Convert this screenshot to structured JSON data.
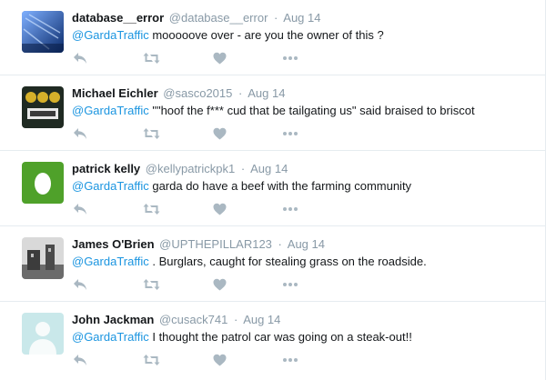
{
  "colors": {
    "mention": "#1b95e0",
    "meta": "#8899a6",
    "action_icon": "#aab8c2",
    "text": "#14171a"
  },
  "icons": {
    "reply": "reply-icon",
    "retweet": "retweet-icon",
    "like": "heart-icon",
    "more": "more-icon"
  },
  "tweets": [
    {
      "name": "database__error",
      "handle": "@database__error",
      "separator": "·",
      "date": "Aug 14",
      "mention": "@GardaTraffic",
      "text": " mooooove over - are you the owner of this ?"
    },
    {
      "name": "Michael Eichler",
      "handle": "@sasco2015",
      "separator": "·",
      "date": "Aug 14",
      "mention": "@GardaTraffic",
      "text": " \"\"hoof the f*** cud that be tailgating us\" said braised to briscot"
    },
    {
      "name": "patrick kelly",
      "handle": "@kellypatrickpk1",
      "separator": "·",
      "date": "Aug 14",
      "mention": "@GardaTraffic",
      "text": " garda do have a beef with the farming community"
    },
    {
      "name": "James O'Brien",
      "handle": "@UPTHEPILLAR123",
      "separator": "·",
      "date": "Aug 14",
      "mention": "@GardaTraffic",
      "text": " . Burglars, caught for stealing grass on the roadside."
    },
    {
      "name": "John Jackman",
      "handle": "@cusack741",
      "separator": "·",
      "date": "Aug 14",
      "mention": "@GardaTraffic",
      "text": "  I thought the patrol car was going on a steak-out!!"
    }
  ]
}
